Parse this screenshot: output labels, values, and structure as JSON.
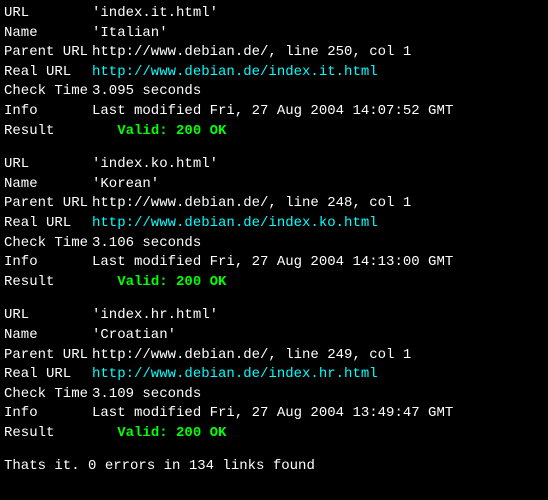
{
  "labels": {
    "url": "URL",
    "name": "Name",
    "parent_url": "Parent URL",
    "real_url": "Real URL",
    "check_time": "Check Time",
    "info": "Info",
    "result": "Result"
  },
  "entries": [
    {
      "url": "'index.it.html'",
      "name": "'Italian'",
      "parent_url": "http://www.debian.de/, line 250, col 1",
      "real_url": "http://www.debian.de/index.it.html",
      "check_time": "3.095 seconds",
      "info": "Last modified Fri, 27 Aug 2004 14:07:52 GMT",
      "result": "Valid: 200 OK"
    },
    {
      "url": "'index.ko.html'",
      "name": "'Korean'",
      "parent_url": "http://www.debian.de/, line 248, col 1",
      "real_url": "http://www.debian.de/index.ko.html",
      "check_time": "3.106 seconds",
      "info": "Last modified Fri, 27 Aug 2004 14:13:00 GMT",
      "result": "Valid: 200 OK"
    },
    {
      "url": "'index.hr.html'",
      "name": "'Croatian'",
      "parent_url": "http://www.debian.de/, line 249, col 1",
      "real_url": "http://www.debian.de/index.hr.html",
      "check_time": "3.109 seconds",
      "info": "Last modified Fri, 27 Aug 2004 13:49:47 GMT",
      "result": "Valid: 200 OK"
    }
  ],
  "summary": "Thats it. 0 errors in 134 links found"
}
